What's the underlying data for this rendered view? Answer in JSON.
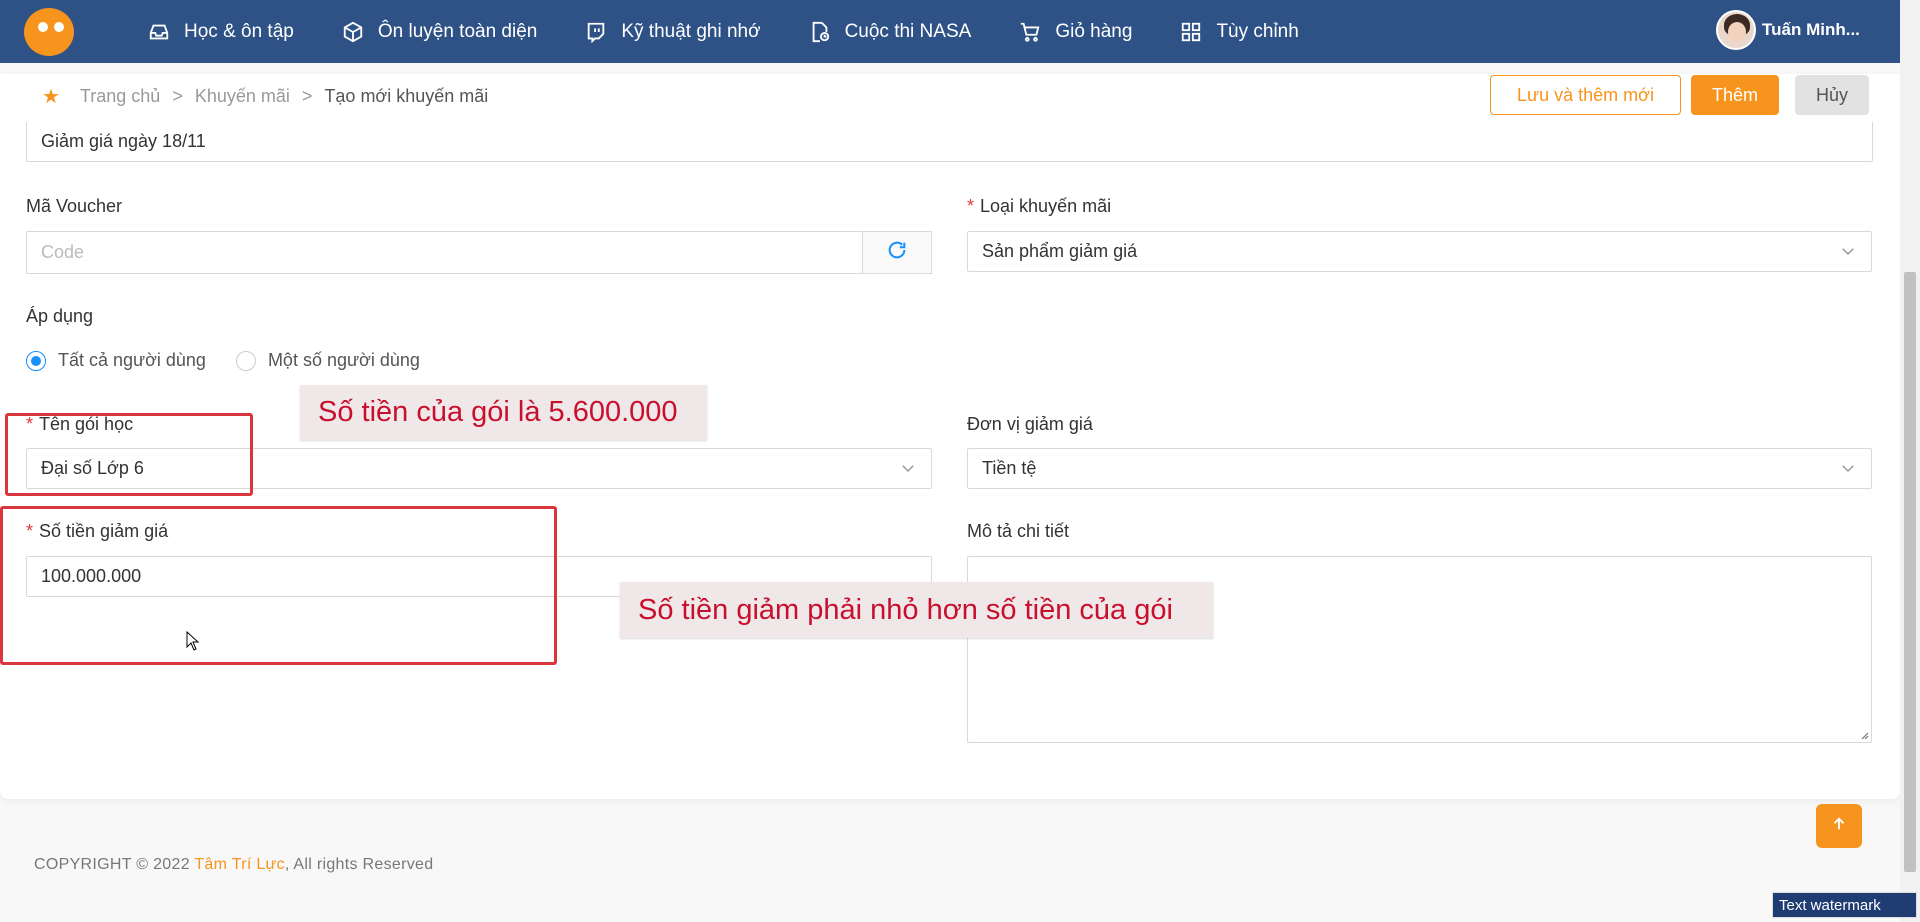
{
  "nav": {
    "items": [
      {
        "label": "Học & ôn tập",
        "icon": "inbox-icon"
      },
      {
        "label": "Ôn luyện toàn diện",
        "icon": "cube-icon"
      },
      {
        "label": "Kỹ thuật ghi nhớ",
        "icon": "twitch-icon"
      },
      {
        "label": "Cuộc thi NASA",
        "icon": "document-clock-icon"
      },
      {
        "label": "Giỏ hàng",
        "icon": "cart-icon"
      },
      {
        "label": "Tùy chỉnh",
        "icon": "grid-icon"
      }
    ],
    "user_name": "Tuấn Minh..."
  },
  "breadcrumb": {
    "home": "Trang chủ",
    "section": "Khuyến mãi",
    "current": "Tạo mới khuyến mãi",
    "separator": ">"
  },
  "actions": {
    "save_add": "Lưu và thêm mới",
    "add": "Thêm",
    "cancel": "Hủy"
  },
  "form": {
    "name_value": "Giảm giá ngày 18/11",
    "voucher_label": "Mã Voucher",
    "voucher_placeholder": "Code",
    "promo_type_label": "Loại khuyến mãi",
    "promo_type_value": "Sản phẩm giảm giá",
    "apply_label": "Áp dụng",
    "apply_options": [
      "Tất cả người dùng",
      "Một số người dùng"
    ],
    "apply_selected": "Tất cả người dùng",
    "package_label": "Tên gói học",
    "package_value": "Đại số Lớp 6",
    "discount_unit_label": "Đơn vị giảm giá",
    "discount_unit_value": "Tiền tệ",
    "discount_amount_label": "Số tiền giảm giá",
    "discount_amount_value": "100.000.000",
    "description_label": "Mô tả chi tiết",
    "required_mark": "*"
  },
  "annotations": {
    "package_price": "Số tiền của gói là 5.600.000",
    "rule": "Số tiền giảm phải nhỏ hơn số tiền của gói"
  },
  "footer": {
    "prefix": "COPYRIGHT © 2022 ",
    "brand": "Tâm Trí Lực",
    "suffix": ", All rights Reserved"
  },
  "watermark": "Text watermark",
  "colors": {
    "navbar": "#2e5186",
    "accent": "#f7941d",
    "annotation": "#d9363e",
    "radio": "#1890ff"
  }
}
